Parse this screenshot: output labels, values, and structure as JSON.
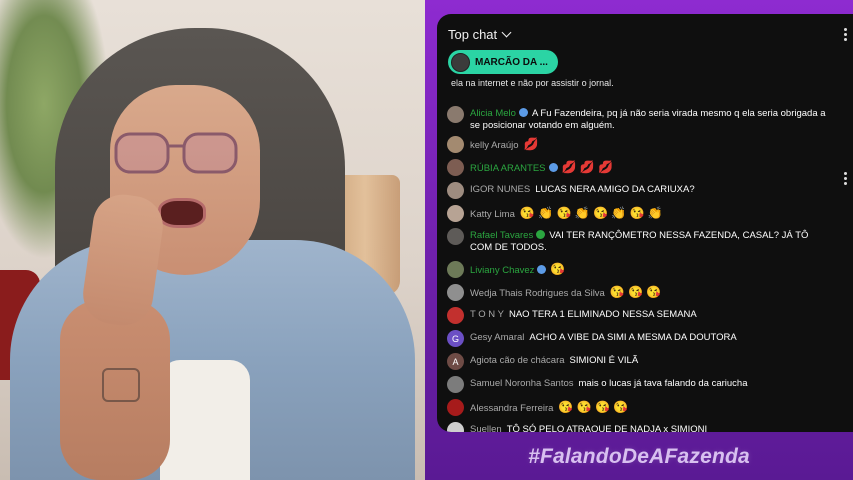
{
  "chat": {
    "title": "Top chat",
    "pinned_label": "MARCÃO DA ...",
    "top_line": "ela na internet e não por assistir o jornal.",
    "messages": [
      {
        "author": "Alicia Melo",
        "member": true,
        "badge": "blue",
        "text": "A Fu Fazendeira, pq já não seria virada mesmo q ela seria obrigada a se posicionar votando em alguém.",
        "emojis": "",
        "avatar_color": "#8a7a6e",
        "avatar_letter": ""
      },
      {
        "author": "kelly Araújo",
        "member": false,
        "badge": "",
        "text": "",
        "emojis": "💋",
        "avatar_color": "#a38a70",
        "avatar_letter": ""
      },
      {
        "author": "RÚBIA ARANTES",
        "member": true,
        "badge": "blue",
        "text": "",
        "emojis": "💋 💋 💋",
        "avatar_color": "#7d5d52",
        "avatar_letter": ""
      },
      {
        "author": "IGOR NUNES",
        "member": false,
        "badge": "",
        "text": "LUCAS NERA AMIGO DA CARIUXA?",
        "emojis": "",
        "avatar_color": "#9e8c80",
        "avatar_letter": ""
      },
      {
        "author": "Katty Lima",
        "member": false,
        "badge": "",
        "text": "",
        "emojis": "😘 👏 😘 👏 😘 👏 😘 👏",
        "avatar_color": "#b7a394",
        "avatar_letter": ""
      },
      {
        "author": "Rafael Tavares",
        "member": true,
        "badge": "green",
        "text": "VAI TER RANÇÔMETRO NESSA FAZENDA, CASAL? JÁ TÔ COM DE TODOS.",
        "emojis": "",
        "avatar_color": "#5e5b58",
        "avatar_letter": ""
      },
      {
        "author": "Liviany Chavez",
        "member": true,
        "badge": "blue",
        "text": "",
        "emojis": "😘",
        "avatar_color": "#6d7a58",
        "avatar_letter": ""
      },
      {
        "author": "Wedja Thais Rodrigues da Silva",
        "member": false,
        "badge": "",
        "text": "",
        "emojis": "😘 😘 😘",
        "avatar_color": "#8f8f8f",
        "avatar_letter": ""
      },
      {
        "author": "T O N Y",
        "member": false,
        "badge": "",
        "text": "NAO TERA 1 ELIMINADO NESSA SEMANA",
        "emojis": "",
        "avatar_color": "#c2302e",
        "avatar_letter": ""
      },
      {
        "author": "Gesy Amaral",
        "member": false,
        "badge": "",
        "text": "ACHO A VIBE DA SIMI A MESMA DA DOUTORA",
        "emojis": "",
        "avatar_color": "#6b4fc4",
        "avatar_letter": "G"
      },
      {
        "author": "Agiota cão de chácara",
        "member": false,
        "badge": "",
        "text": "SIMIONI É VILÃ",
        "emojis": "",
        "avatar_color": "#6e4b45",
        "avatar_letter": "A"
      },
      {
        "author": "Samuel Noronha Santos",
        "member": false,
        "badge": "",
        "text": "mais o lucas já tava falando da cariucha",
        "emojis": "",
        "avatar_color": "#7c7c7c",
        "avatar_letter": ""
      },
      {
        "author": "Alessandra Ferreira",
        "member": false,
        "badge": "",
        "text": "",
        "emojis": "😘 😘 😘 😘",
        "avatar_color": "#a61b1b",
        "avatar_letter": ""
      },
      {
        "author": "Suellen",
        "member": false,
        "badge": "",
        "text": "TÔ SÓ PELO ATRAQUE DE NADJA x SIMIONI",
        "emojis": "",
        "avatar_color": "#cfcfcf",
        "avatar_letter": ""
      }
    ]
  },
  "hashtag": "#FalandoDeAFazenda",
  "colors": {
    "frame_purple": "#7a1fb0",
    "chat_bg": "#0f0f0f",
    "pinned_green": "#2bd4a4",
    "member_green": "#2ba640"
  }
}
